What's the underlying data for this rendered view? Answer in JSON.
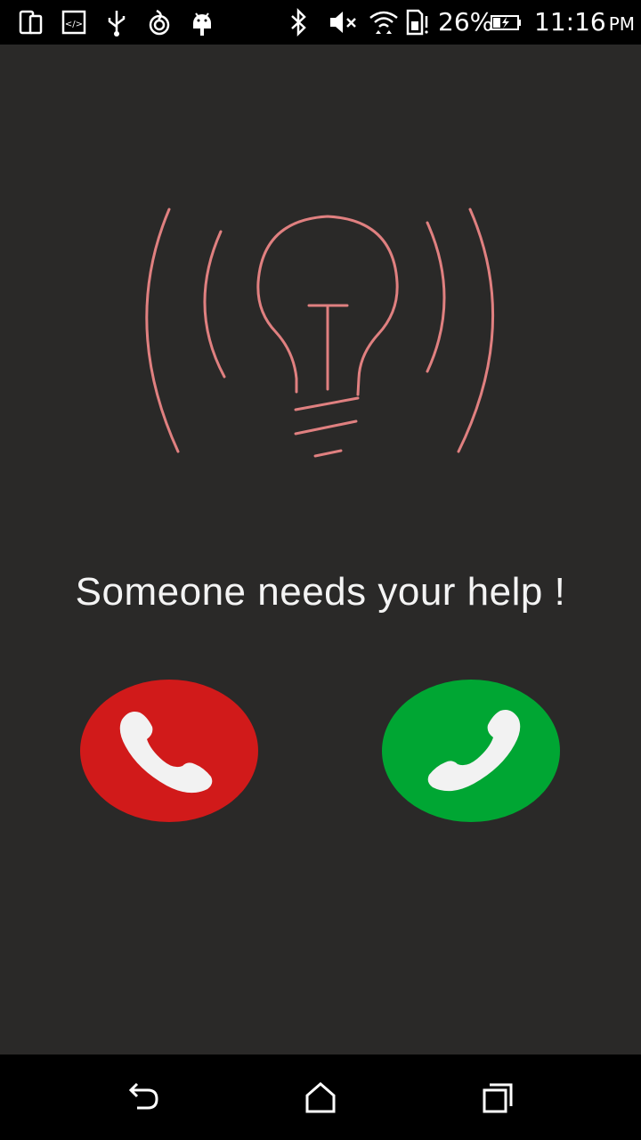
{
  "status_bar": {
    "battery_percent": "26%",
    "time": "11:16",
    "ampm": "PM",
    "icons": [
      "dual-screen-icon",
      "code-icon",
      "usb-icon",
      "hotspot-icon",
      "android-debug-icon",
      "bluetooth-icon",
      "mute-icon",
      "wifi-icon",
      "sim-alert-icon",
      "battery-charging-icon"
    ]
  },
  "main": {
    "illustration": "lightbulb-icon",
    "message": "Someone needs your help !",
    "decline_label": "decline-call",
    "accept_label": "accept-call"
  },
  "colors": {
    "background": "#2a2928",
    "bulb_stroke": "#e08080",
    "decline": "#d11a1a",
    "accept": "#00a633"
  },
  "nav_bar": {
    "items": [
      "back-icon",
      "home-icon",
      "recents-icon"
    ]
  }
}
